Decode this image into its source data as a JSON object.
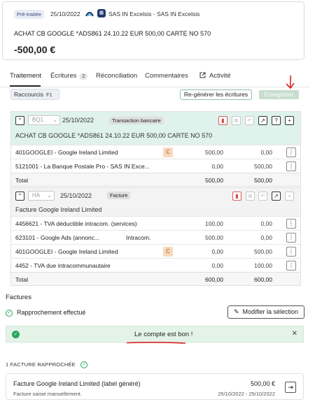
{
  "header": {
    "status_badge": "Pré-traitée",
    "date": "25/10/2022",
    "bank_name": "SAS IN Excelsis - SAS IN Excelsis",
    "label": "ACHAT CB GOOGLE *ADS861 24.10.22 EUR 500,00 CARTE NO 570",
    "amount": "-500,00 €"
  },
  "tabs": [
    {
      "label": "Traitement"
    },
    {
      "label": "Écritures",
      "count": "2"
    },
    {
      "label": "Réconciliation"
    },
    {
      "label": "Commentaires"
    },
    {
      "label": "Activité"
    }
  ],
  "toolbar": {
    "shortcuts_label": "Raccourcis",
    "shortcuts_key": "F1",
    "regen_label": "Re-générer les écritures",
    "save_label": "Enregistrer"
  },
  "entries": [
    {
      "journal": "BQ1",
      "date": "25/10/2022",
      "type": "Transaction bancaire",
      "label": "ACHAT CB GOOGLE *ADS861 24.10.22 EUR 500,00 CARTE NO 570",
      "lines": [
        {
          "account": "401GOOGLEI - Google Ireland Limited",
          "mid": "",
          "badge": "C",
          "debit": "500,00",
          "credit": "0,00"
        },
        {
          "account": "5121001 - La Banque Postale Pro - SAS IN Exce...",
          "mid": "",
          "badge": "",
          "debit": "0,00",
          "credit": "500,00"
        }
      ],
      "total_label": "Total",
      "total_debit": "500,00",
      "total_credit": "500,00"
    },
    {
      "journal": "HA",
      "date": "25/10/2022",
      "type": "Facture",
      "label": "Facture Google Ireland Limited",
      "lines": [
        {
          "account": "4456621 - TVA déductible intracom. (services)",
          "mid": "",
          "badge": "",
          "debit": "100,00",
          "credit": "0,00"
        },
        {
          "account": "623101 - Google Ads (annonc...",
          "mid": "Intracom.",
          "badge": "",
          "debit": "500,00",
          "credit": "0,00"
        },
        {
          "account": "401GOOGLEI - Google Ireland Limited",
          "mid": "",
          "badge": "C",
          "debit": "0,00",
          "credit": "500,00"
        },
        {
          "account": "4452 - TVA due intracommunautaire",
          "mid": "",
          "badge": "",
          "debit": "0,00",
          "credit": "100,00"
        }
      ],
      "total_label": "Total",
      "total_debit": "600,00",
      "total_credit": "600,00"
    }
  ],
  "factures": {
    "title": "Factures",
    "rapprochement": "Rapprochement effectué",
    "modify_label": "Modifier la sélection",
    "ok_message": "Le compte est bon !",
    "count_label": "1 FACTURE RAPPROCHÉE",
    "invoice": {
      "name": "Facture Google Ireland Limited (label généré)",
      "sub": "Facture saisie manuellement.",
      "amount": "500,00 €",
      "dates": "25/10/2022 - 25/10/2022"
    }
  },
  "colors": {
    "accent_green": "#2aa65c",
    "entry_header": "#dff2ec",
    "annotation_red": "#d9251c"
  }
}
